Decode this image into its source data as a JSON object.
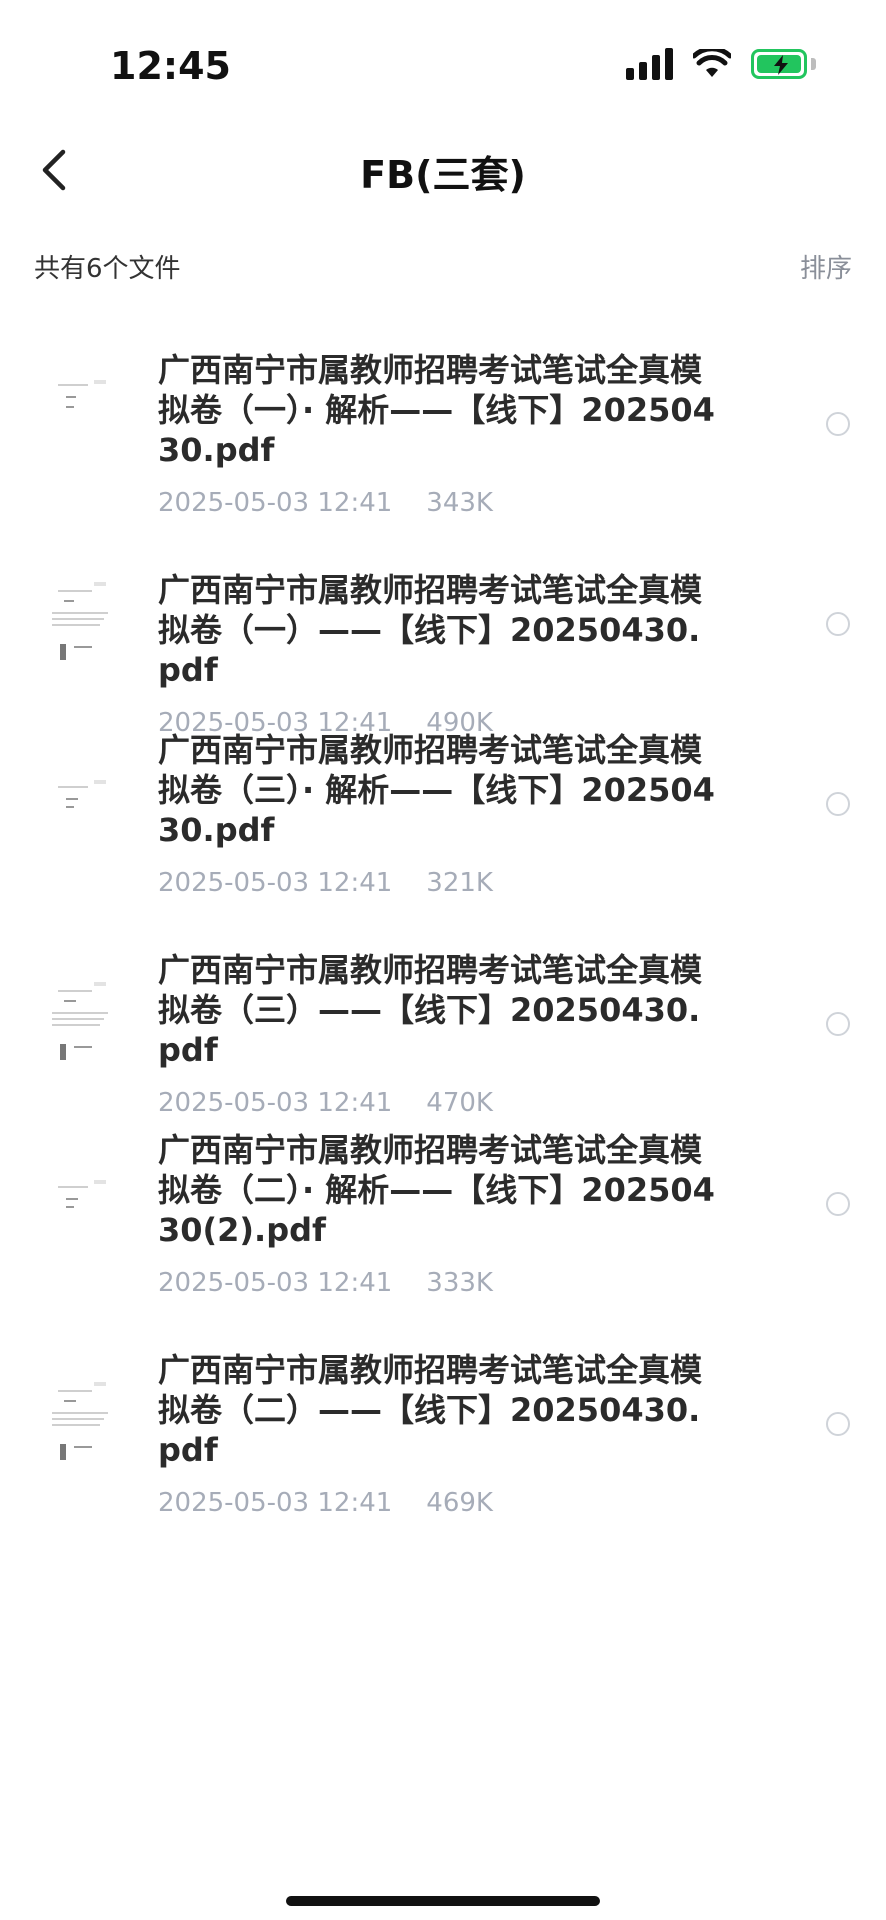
{
  "status_bar": {
    "time": "12:45"
  },
  "nav": {
    "title": "FB(三套)"
  },
  "summary": {
    "count_label": "共有6个文件",
    "sort_label": "排序"
  },
  "files": [
    {
      "name": "广西南宁市属教师招聘考试笔试全真模拟卷（一）· 解析——【线下】20250430.pdf",
      "date": "2025-05-03 12:41",
      "size": "343K"
    },
    {
      "name": "广西南宁市属教师招聘考试笔试全真模拟卷（一）——【线下】20250430.pdf",
      "date": "2025-05-03 12:41",
      "size": "490K"
    },
    {
      "name": "广西南宁市属教师招聘考试笔试全真模拟卷（三）· 解析——【线下】20250430.pdf",
      "date": "2025-05-03 12:41",
      "size": "321K"
    },
    {
      "name": "广西南宁市属教师招聘考试笔试全真模拟卷（三）——【线下】20250430.pdf",
      "date": "2025-05-03 12:41",
      "size": "470K"
    },
    {
      "name": "广西南宁市属教师招聘考试笔试全真模拟卷（二）· 解析——【线下】20250430(2).pdf",
      "date": "2025-05-03 12:41",
      "size": "333K"
    },
    {
      "name": "广西南宁市属教师招聘考试笔试全真模拟卷（二）——【线下】20250430.pdf",
      "date": "2025-05-03 12:41",
      "size": "469K"
    }
  ]
}
